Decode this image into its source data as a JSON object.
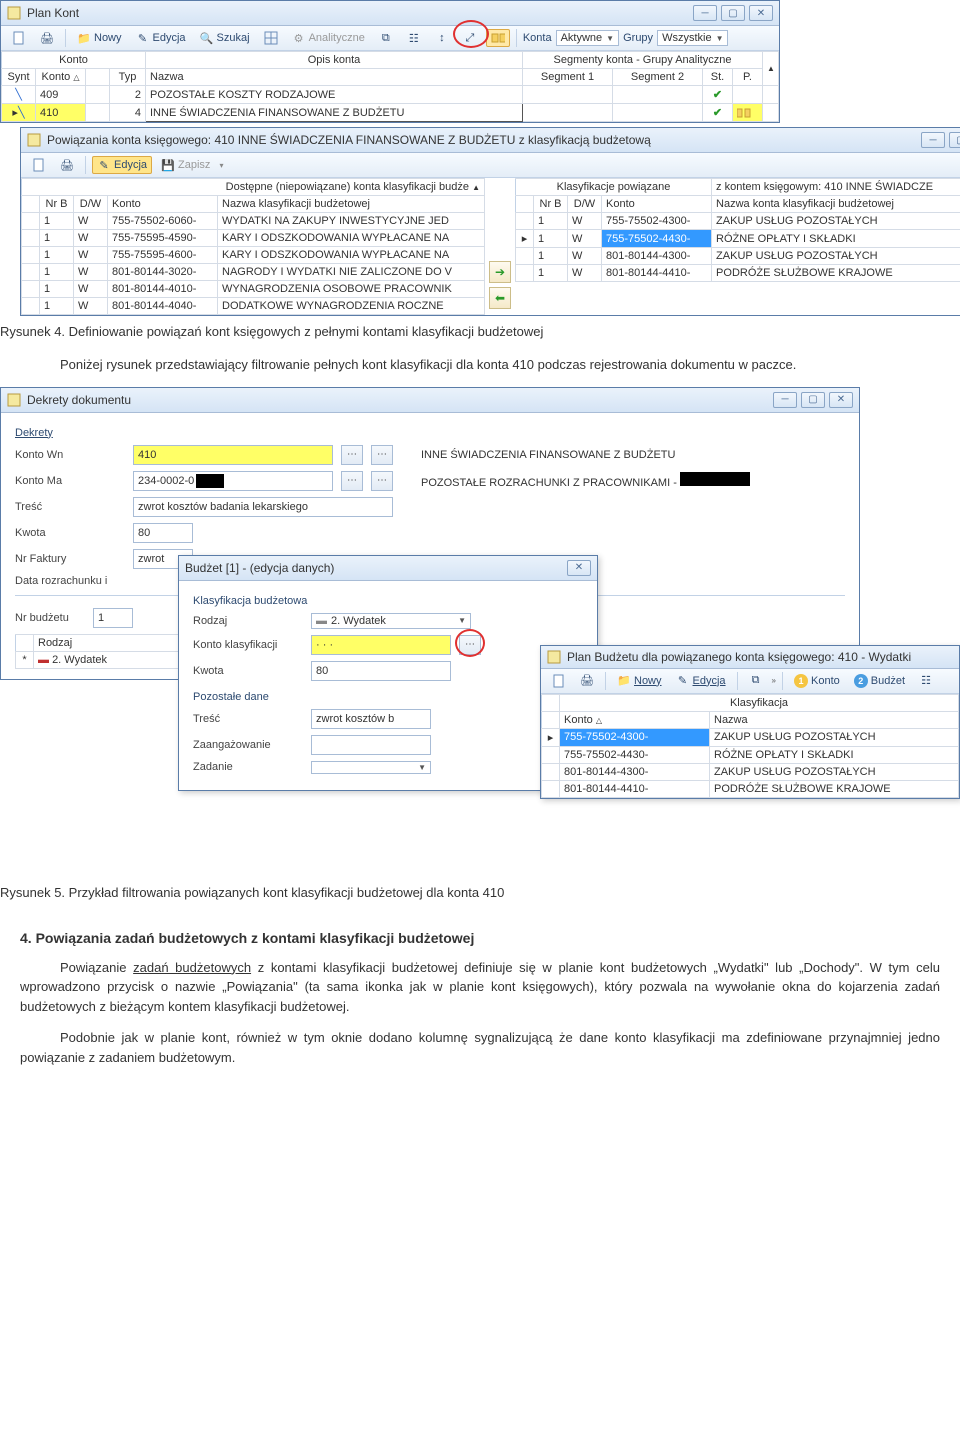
{
  "fig1": {
    "title": "Plan Kont",
    "toolbar": {
      "nowy": "Nowy",
      "edycja": "Edycja",
      "szukaj": "Szukaj",
      "analityczne": "Analityczne",
      "konta_label": "Konta",
      "konta_value": "Aktywne",
      "grupy_label": "Grupy",
      "grupy_value": "Wszystkie"
    },
    "headers": {
      "konto": "Konto",
      "opis": "Opis konta",
      "segmenty": "Segmenty konta - Grupy Analityczne",
      "synt": "Synt",
      "konto2": "Konto",
      "typ": "Typ",
      "nazwa": "Nazwa",
      "seg1": "Segment 1",
      "seg2": "Segment 2",
      "st": "St.",
      "p": "P."
    },
    "rows": [
      {
        "konto": "409",
        "typ": "2",
        "nazwa": "POZOSTAŁE KOSZTY RODZAJOWE"
      },
      {
        "konto": "410",
        "typ": "4",
        "nazwa": "INNE ŚWIADCZENIA FINANSOWANE Z BUDŻETU",
        "hl": true
      }
    ]
  },
  "fig2": {
    "title": "Powiązania konta księgowego:  410  INNE ŚWIADCZENIA FINANSOWANE Z BUDŻETU  z klasyfikacją budżetową",
    "toolbar": {
      "edycja": "Edycja",
      "zapisz": "Zapisz"
    },
    "left_header": "Dostępne (niepowiązane) konta klasyfikacji budże",
    "right_header1": "Klasyfikacje powiązane",
    "right_header2": "z kontem księgowym:  410  INNE ŚWIADCZE",
    "cols": {
      "nrb": "Nr B",
      "dw": "D/W",
      "konto": "Konto",
      "nazwa": "Nazwa klasyfikacji budżetowej",
      "nazwa2": "Nazwa konta klasyfikacji budżetowej"
    },
    "left_rows": [
      {
        "nrb": "1",
        "dw": "W",
        "konto": "755-75502-6060-",
        "nazwa": "WYDATKI NA ZAKUPY INWESTYCYJNE JED"
      },
      {
        "nrb": "1",
        "dw": "W",
        "konto": "755-75595-4590-",
        "nazwa": "KARY I ODSZKODOWANIA WYPŁACANE NA"
      },
      {
        "nrb": "1",
        "dw": "W",
        "konto": "755-75595-4600-",
        "nazwa": "KARY I ODSZKODOWANIA WYPŁACANE NA"
      },
      {
        "nrb": "1",
        "dw": "W",
        "konto": "801-80144-3020-",
        "nazwa": "NAGRODY I WYDATKI NIE ZALICZONE DO V"
      },
      {
        "nrb": "1",
        "dw": "W",
        "konto": "801-80144-4010-",
        "nazwa": "WYNAGRODZENIA OSOBOWE PRACOWNIK"
      },
      {
        "nrb": "1",
        "dw": "W",
        "konto": "801-80144-4040-",
        "nazwa": "DODATKOWE WYNAGRODZENIA ROCZNE"
      }
    ],
    "right_rows": [
      {
        "nrb": "1",
        "dw": "W",
        "konto": "755-75502-4300-",
        "nazwa": "ZAKUP USŁUG POZOSTAŁYCH"
      },
      {
        "nrb": "1",
        "dw": "W",
        "konto": "755-75502-4430-",
        "nazwa": "RÓŻNE OPŁATY I SKŁADKI",
        "sel": true
      },
      {
        "nrb": "1",
        "dw": "W",
        "konto": "801-80144-4300-",
        "nazwa": "ZAKUP USŁUG POZOSTAŁYCH"
      },
      {
        "nrb": "1",
        "dw": "W",
        "konto": "801-80144-4410-",
        "nazwa": "PODRÓŻE SŁUŻBOWE KRAJOWE"
      }
    ]
  },
  "caption4": "Rysunek 4. Definiowanie powiązań kont księgowych z pełnymi kontami klasyfikacji budżetowej",
  "para1": "Poniżej rysunek przedstawiający filtrowanie pełnych kont klasyfikacji dla konta 410 podczas rejestrowania dokumentu w paczce.",
  "fig3": {
    "title": "Dekrety dokumentu",
    "group": "Dekrety",
    "labels": {
      "konto_wn": "Konto Wn",
      "konto_ma": "Konto Ma",
      "tresc": "Treść",
      "kwota": "Kwota",
      "nr_faktury": "Nr Faktury",
      "data": "Data rozrachunku i"
    },
    "values": {
      "konto_wn": "410",
      "konto_ma": "234-0002-0",
      "wn_desc": "INNE ŚWIADCZENIA FINANSOWANE Z BUDŻETU",
      "ma_desc": "POZOSTAŁE ROZRACHUNKI Z PRACOWNIKAMI -",
      "tresc": "zwrot kosztów badania lekarskiego",
      "kwota": "80",
      "nr_faktury": "zwrot"
    },
    "sidegrid": {
      "nrbud": "Nr budżetu",
      "nrbud_val": "1",
      "rodzaj": "Rodzaj",
      "rodzaj_val": "2. Wydatek"
    }
  },
  "fig4": {
    "title": "Budżet [1]  -  (edycja danych)",
    "group": "Klasyfikacja budżetowa",
    "group2": "Pozostałe dane",
    "labels": {
      "rodzaj": "Rodzaj",
      "rodzaj_val": "2. Wydatek",
      "konto_klas": "Konto klasyfikacji",
      "konto_klas_val": " ·   ·   · ",
      "kwota": "Kwota",
      "kwota_val": "80",
      "tresc": "Treść",
      "tresc_val": "zwrot kosztów b",
      "zaang": "Zaangażowanie",
      "zadanie": "Zadanie"
    }
  },
  "fig5": {
    "title": "Plan Budżetu dla powiązanego konta księgowego: 410   - Wydatki",
    "toolbar": {
      "nowy": "Nowy",
      "edycja": "Edycja",
      "konto": "Konto",
      "budzet": "Budżet"
    },
    "header_group": "Klasyfikacja",
    "cols": {
      "konto": "Konto",
      "nazwa": "Nazwa"
    },
    "rows": [
      {
        "konto": "755-75502-4300-",
        "nazwa": "ZAKUP USŁUG POZOSTAŁYCH",
        "sel": true
      },
      {
        "konto": "755-75502-4430-",
        "nazwa": "RÓŻNE OPŁATY I SKŁADKI"
      },
      {
        "konto": "801-80144-4300-",
        "nazwa": "ZAKUP USŁUG POZOSTAŁYCH"
      },
      {
        "konto": "801-80144-4410-",
        "nazwa": "PODRÓŻE SŁUŻBOWE KRAJOWE"
      }
    ]
  },
  "caption5": "Rysunek 5. Przykład filtrowania powiązanych kont klasyfikacji budżetowej dla konta 410",
  "heading4": "4. Powiązania zadań budżetowych z kontami klasyfikacji budżetowej",
  "para2a": "Powiązanie ",
  "para2b": "zadań budżetowych",
  "para2c": " z kontami klasyfikacji budżetowej definiuje się w planie kont budżetowych „Wydatki\" lub „Dochody\".  W tym celu wprowadzono przycisk o nazwie „Powiązania\" (ta sama ikonka jak w planie kont księgowych),  który pozwala na wywołanie okna do kojarzenia zadań budżetowych z bieżącym kontem klasyfikacji budżetowej.",
  "para3": "Podobnie jak w planie kont, również w tym oknie dodano kolumnę sygnalizującą że dane konto klasyfikacji ma zdefiniowane przynajmniej jedno powiązanie z zadaniem budżetowym."
}
